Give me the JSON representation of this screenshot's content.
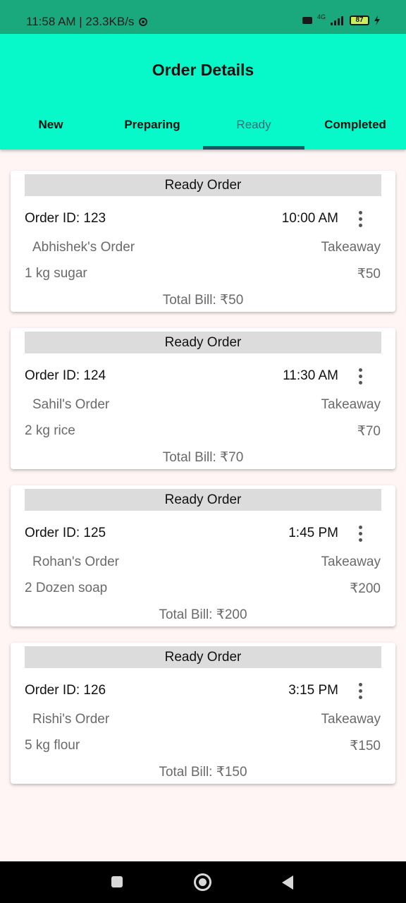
{
  "status_bar": {
    "time_speed": "11:58 AM | 23.3KB/s",
    "settings_icon": "gear-icon",
    "network_label": "4G",
    "battery": "87"
  },
  "app_bar": {
    "title": "Order Details",
    "tabs": [
      {
        "label": "New"
      },
      {
        "label": "Preparing"
      },
      {
        "label": "Ready"
      },
      {
        "label": "Completed"
      }
    ],
    "active_tab": "Ready",
    "accent_color": "#07f9c9",
    "indicator_color": "#1a5566"
  },
  "orders": [
    {
      "header": "Ready Order",
      "order_id": "Order ID: 123",
      "time": "10:00 AM",
      "customer": "Abhishek's Order",
      "type": "Takeaway",
      "item": "1 kg sugar",
      "price": "₹50",
      "total": "Total Bill: ₹50"
    },
    {
      "header": "Ready Order",
      "order_id": "Order ID: 124",
      "time": "11:30 AM",
      "customer": "Sahil's Order",
      "type": "Takeaway",
      "item": "2 kg rice",
      "price": "₹70",
      "total": "Total Bill: ₹70"
    },
    {
      "header": "Ready Order",
      "order_id": "Order ID: 125",
      "time": "1:45 PM",
      "customer": "Rohan's Order",
      "type": "Takeaway",
      "item": "2 Dozen soap",
      "price": "₹200",
      "total": "Total Bill: ₹200"
    },
    {
      "header": "Ready Order",
      "order_id": "Order ID: 126",
      "time": "3:15 PM",
      "customer": "Rishi's Order",
      "type": "Takeaway",
      "item": "5 kg flour",
      "price": "₹150",
      "total": "Total Bill: ₹150"
    }
  ],
  "nav_bar": {
    "recent_icon": "recent-apps-icon",
    "home_icon": "home-icon",
    "back_icon": "back-icon"
  }
}
